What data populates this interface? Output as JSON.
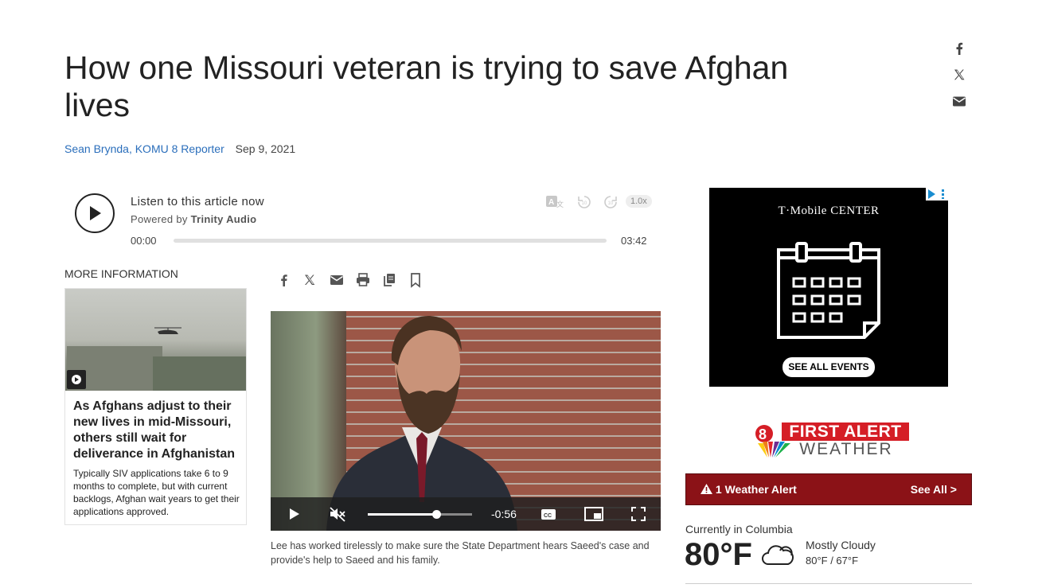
{
  "article": {
    "headline": "How one Missouri veteran is trying to save Afghan lives",
    "author": "Sean Brynda, KOMU 8 Reporter",
    "date": "Sep 9, 2021"
  },
  "share_rail": {
    "icons": [
      "facebook-icon",
      "x-icon",
      "email-icon"
    ]
  },
  "audio_player": {
    "title": "Listen to this article now",
    "powered_prefix": "Powered by ",
    "powered_brand": "Trinity Audio",
    "current_time": "00:00",
    "duration": "03:42",
    "speed": "1.0x",
    "progress": 0
  },
  "more_info": {
    "label": "MORE INFORMATION",
    "card": {
      "title": "As Afghans adjust to their new lives in mid-Missouri, others still wait for deliverance in Afghanistan",
      "summary": "Typically SIV applications take 6 to 9 months to complete, but with current backlogs, Afghan wait years to get their applications approved."
    }
  },
  "tools": [
    "facebook-icon",
    "x-icon",
    "email-icon",
    "print-icon",
    "copy-icon",
    "bookmark-icon"
  ],
  "video": {
    "time_remaining": "-0:56",
    "progress": 0.66,
    "caption": "Lee has worked tirelessly to make sure the State Department hears Saeed's case and provide's help to Saeed and his family."
  },
  "ad": {
    "brand": "T·Mobile CENTER",
    "cta": "SEE ALL EVENTS"
  },
  "weather": {
    "logo_top": "FIRST ALERT",
    "logo_bottom": "WEATHER",
    "alert_text": "1 Weather Alert",
    "see_all": "See All >",
    "location_label": "Currently in Columbia",
    "temperature": "80°F",
    "condition": "Mostly Cloudy",
    "hi_lo": "80°F / 67°F"
  },
  "colors": {
    "link": "#2a6ebb",
    "alert_bg": "#8b1217",
    "brand_red": "#d51e26"
  }
}
